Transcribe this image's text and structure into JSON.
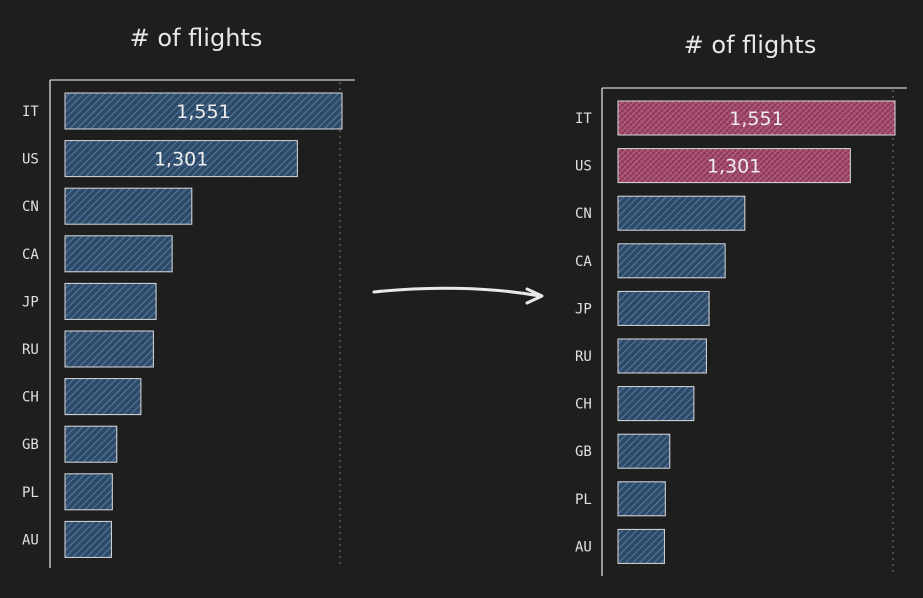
{
  "chart_data": [
    {
      "type": "bar",
      "orientation": "horizontal",
      "title": "# of flights",
      "categories": [
        "IT",
        "US",
        "CN",
        "CA",
        "JP",
        "RU",
        "CH",
        "GB",
        "PL",
        "AU"
      ],
      "values": [
        1551,
        1301,
        710,
        600,
        510,
        495,
        425,
        290,
        265,
        260
      ],
      "value_labels": [
        "1,551",
        "1,301"
      ],
      "highlight": [],
      "xlim": [
        0,
        1600
      ],
      "colors": {
        "base": "#3b5f86",
        "highlight": "#b45476"
      }
    },
    {
      "type": "bar",
      "orientation": "horizontal",
      "title": "# of flights",
      "categories": [
        "IT",
        "US",
        "CN",
        "CA",
        "JP",
        "RU",
        "CH",
        "GB",
        "PL",
        "AU"
      ],
      "values": [
        1551,
        1301,
        710,
        600,
        510,
        495,
        425,
        290,
        265,
        260
      ],
      "value_labels": [
        "1,551",
        "1,301"
      ],
      "highlight": [
        "IT",
        "US"
      ],
      "xlim": [
        0,
        1600
      ],
      "colors": {
        "base": "#3b5f86",
        "highlight": "#b45476"
      }
    }
  ],
  "arrow": {
    "color": "#e8e8e8"
  }
}
